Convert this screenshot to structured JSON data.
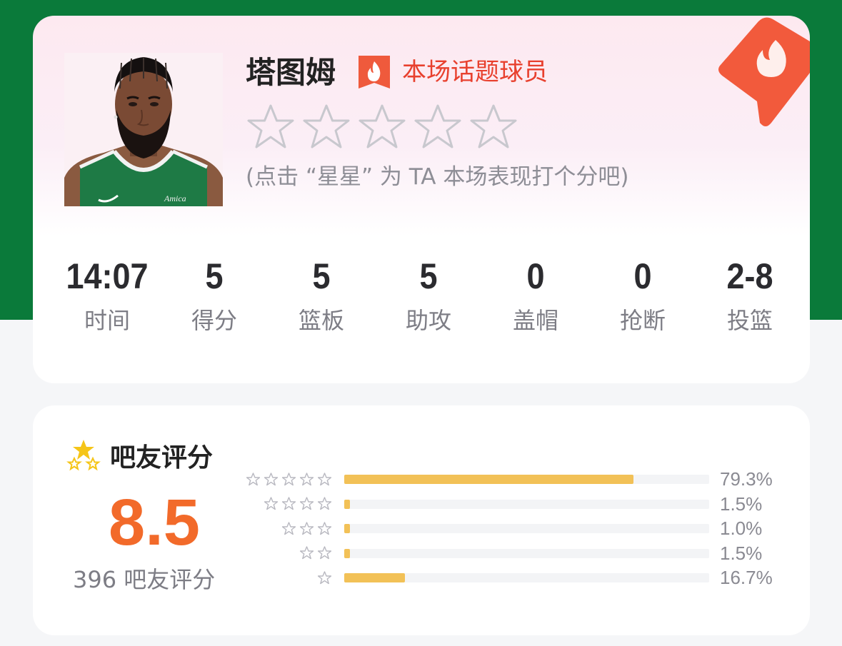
{
  "colors": {
    "green_band": "#0a7a3a",
    "accent_orange": "#f26a2a",
    "hot_red": "#e8402e",
    "bar_fill": "#f2c157",
    "bar_track": "#f3f4f6"
  },
  "player": {
    "name": "塔图姆",
    "hot_badge_icon": "flame-icon",
    "hot_label": "本场话题球员",
    "rating_stars": 5,
    "rating_hint": "(点击 “星星” 为 TA 本场表现打个分吧)",
    "jersey_text": "Amica",
    "stats": [
      {
        "value": "14:07",
        "label": "时间"
      },
      {
        "value": "5",
        "label": "得分"
      },
      {
        "value": "5",
        "label": "篮板"
      },
      {
        "value": "5",
        "label": "助攻"
      },
      {
        "value": "0",
        "label": "盖帽"
      },
      {
        "value": "0",
        "label": "抢断"
      },
      {
        "value": "2-8",
        "label": "投篮"
      }
    ]
  },
  "rating": {
    "title": "吧友评分",
    "title_icon": "three-stars-icon",
    "score": "8.5",
    "count_label": "396 吧友评分",
    "distribution": [
      {
        "stars": 5,
        "percent": "79.3%",
        "fraction": 0.793
      },
      {
        "stars": 4,
        "percent": "1.5%",
        "fraction": 0.015
      },
      {
        "stars": 3,
        "percent": "1.0%",
        "fraction": 0.01
      },
      {
        "stars": 2,
        "percent": "1.5%",
        "fraction": 0.015
      },
      {
        "stars": 1,
        "percent": "16.7%",
        "fraction": 0.167
      }
    ]
  }
}
